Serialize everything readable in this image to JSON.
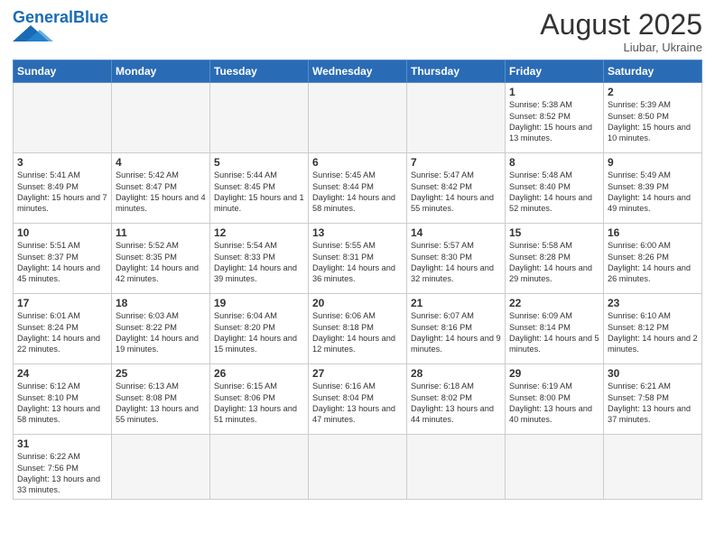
{
  "header": {
    "logo_general": "General",
    "logo_blue": "Blue",
    "month_title": "August 2025",
    "location": "Liubar, Ukraine"
  },
  "weekdays": [
    "Sunday",
    "Monday",
    "Tuesday",
    "Wednesday",
    "Thursday",
    "Friday",
    "Saturday"
  ],
  "weeks": [
    [
      {
        "day": "",
        "info": ""
      },
      {
        "day": "",
        "info": ""
      },
      {
        "day": "",
        "info": ""
      },
      {
        "day": "",
        "info": ""
      },
      {
        "day": "",
        "info": ""
      },
      {
        "day": "1",
        "info": "Sunrise: 5:38 AM\nSunset: 8:52 PM\nDaylight: 15 hours and 13 minutes."
      },
      {
        "day": "2",
        "info": "Sunrise: 5:39 AM\nSunset: 8:50 PM\nDaylight: 15 hours and 10 minutes."
      }
    ],
    [
      {
        "day": "3",
        "info": "Sunrise: 5:41 AM\nSunset: 8:49 PM\nDaylight: 15 hours and 7 minutes."
      },
      {
        "day": "4",
        "info": "Sunrise: 5:42 AM\nSunset: 8:47 PM\nDaylight: 15 hours and 4 minutes."
      },
      {
        "day": "5",
        "info": "Sunrise: 5:44 AM\nSunset: 8:45 PM\nDaylight: 15 hours and 1 minute."
      },
      {
        "day": "6",
        "info": "Sunrise: 5:45 AM\nSunset: 8:44 PM\nDaylight: 14 hours and 58 minutes."
      },
      {
        "day": "7",
        "info": "Sunrise: 5:47 AM\nSunset: 8:42 PM\nDaylight: 14 hours and 55 minutes."
      },
      {
        "day": "8",
        "info": "Sunrise: 5:48 AM\nSunset: 8:40 PM\nDaylight: 14 hours and 52 minutes."
      },
      {
        "day": "9",
        "info": "Sunrise: 5:49 AM\nSunset: 8:39 PM\nDaylight: 14 hours and 49 minutes."
      }
    ],
    [
      {
        "day": "10",
        "info": "Sunrise: 5:51 AM\nSunset: 8:37 PM\nDaylight: 14 hours and 45 minutes."
      },
      {
        "day": "11",
        "info": "Sunrise: 5:52 AM\nSunset: 8:35 PM\nDaylight: 14 hours and 42 minutes."
      },
      {
        "day": "12",
        "info": "Sunrise: 5:54 AM\nSunset: 8:33 PM\nDaylight: 14 hours and 39 minutes."
      },
      {
        "day": "13",
        "info": "Sunrise: 5:55 AM\nSunset: 8:31 PM\nDaylight: 14 hours and 36 minutes."
      },
      {
        "day": "14",
        "info": "Sunrise: 5:57 AM\nSunset: 8:30 PM\nDaylight: 14 hours and 32 minutes."
      },
      {
        "day": "15",
        "info": "Sunrise: 5:58 AM\nSunset: 8:28 PM\nDaylight: 14 hours and 29 minutes."
      },
      {
        "day": "16",
        "info": "Sunrise: 6:00 AM\nSunset: 8:26 PM\nDaylight: 14 hours and 26 minutes."
      }
    ],
    [
      {
        "day": "17",
        "info": "Sunrise: 6:01 AM\nSunset: 8:24 PM\nDaylight: 14 hours and 22 minutes."
      },
      {
        "day": "18",
        "info": "Sunrise: 6:03 AM\nSunset: 8:22 PM\nDaylight: 14 hours and 19 minutes."
      },
      {
        "day": "19",
        "info": "Sunrise: 6:04 AM\nSunset: 8:20 PM\nDaylight: 14 hours and 15 minutes."
      },
      {
        "day": "20",
        "info": "Sunrise: 6:06 AM\nSunset: 8:18 PM\nDaylight: 14 hours and 12 minutes."
      },
      {
        "day": "21",
        "info": "Sunrise: 6:07 AM\nSunset: 8:16 PM\nDaylight: 14 hours and 9 minutes."
      },
      {
        "day": "22",
        "info": "Sunrise: 6:09 AM\nSunset: 8:14 PM\nDaylight: 14 hours and 5 minutes."
      },
      {
        "day": "23",
        "info": "Sunrise: 6:10 AM\nSunset: 8:12 PM\nDaylight: 14 hours and 2 minutes."
      }
    ],
    [
      {
        "day": "24",
        "info": "Sunrise: 6:12 AM\nSunset: 8:10 PM\nDaylight: 13 hours and 58 minutes."
      },
      {
        "day": "25",
        "info": "Sunrise: 6:13 AM\nSunset: 8:08 PM\nDaylight: 13 hours and 55 minutes."
      },
      {
        "day": "26",
        "info": "Sunrise: 6:15 AM\nSunset: 8:06 PM\nDaylight: 13 hours and 51 minutes."
      },
      {
        "day": "27",
        "info": "Sunrise: 6:16 AM\nSunset: 8:04 PM\nDaylight: 13 hours and 47 minutes."
      },
      {
        "day": "28",
        "info": "Sunrise: 6:18 AM\nSunset: 8:02 PM\nDaylight: 13 hours and 44 minutes."
      },
      {
        "day": "29",
        "info": "Sunrise: 6:19 AM\nSunset: 8:00 PM\nDaylight: 13 hours and 40 minutes."
      },
      {
        "day": "30",
        "info": "Sunrise: 6:21 AM\nSunset: 7:58 PM\nDaylight: 13 hours and 37 minutes."
      }
    ],
    [
      {
        "day": "31",
        "info": "Sunrise: 6:22 AM\nSunset: 7:56 PM\nDaylight: 13 hours and 33 minutes."
      },
      {
        "day": "",
        "info": ""
      },
      {
        "day": "",
        "info": ""
      },
      {
        "day": "",
        "info": ""
      },
      {
        "day": "",
        "info": ""
      },
      {
        "day": "",
        "info": ""
      },
      {
        "day": "",
        "info": ""
      }
    ]
  ]
}
